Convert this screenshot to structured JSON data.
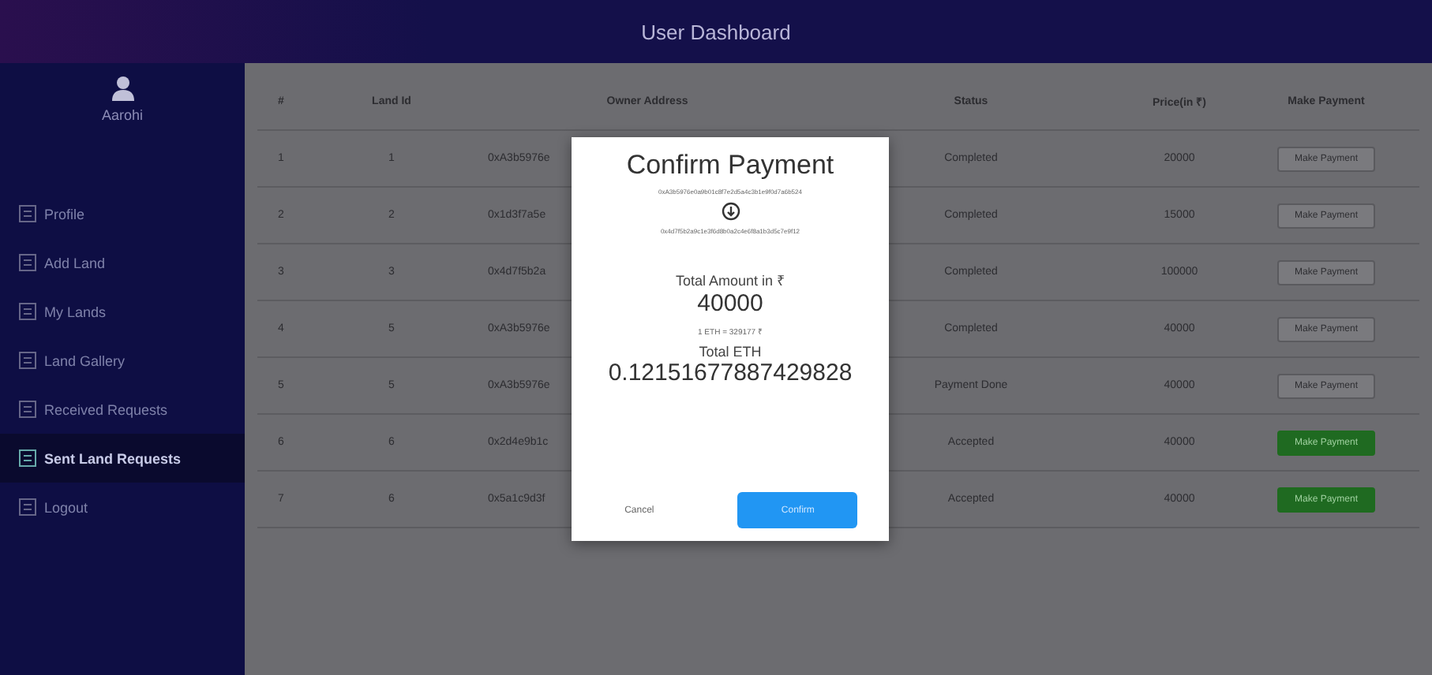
{
  "header": {
    "title": "User Dashboard"
  },
  "sidebar": {
    "user": "Aarohi",
    "items": [
      {
        "label": "Profile",
        "selected": false
      },
      {
        "label": "Add Land",
        "selected": false
      },
      {
        "label": "My Lands",
        "selected": false
      },
      {
        "label": "Land Gallery",
        "selected": false
      },
      {
        "label": "Received Requests",
        "selected": false
      },
      {
        "label": "Sent Land Requests",
        "selected": true
      },
      {
        "label": "Logout",
        "selected": false
      }
    ]
  },
  "table": {
    "columns": [
      "#",
      "Land Id",
      "Owner Address",
      "Status",
      "Price(in ₹)",
      "Make Payment"
    ],
    "rows": [
      {
        "cells": [
          "1",
          "1",
          "0xA3b5976e",
          "Completed",
          "20000"
        ],
        "button": "Make Payment",
        "disabled": true
      },
      {
        "cells": [
          "2",
          "2",
          "0x1d3f7a5e",
          "Completed",
          "15000"
        ],
        "button": "Make Payment",
        "disabled": true
      },
      {
        "cells": [
          "3",
          "3",
          "0x4d7f5b2a",
          "Completed",
          "100000"
        ],
        "button": "Make Payment",
        "disabled": true
      },
      {
        "cells": [
          "4",
          "5",
          "0xA3b5976e",
          "Completed",
          "40000"
        ],
        "button": "Make Payment",
        "disabled": true
      },
      {
        "cells": [
          "5",
          "5",
          "0xA3b5976e",
          "Payment Done",
          "40000"
        ],
        "button": "Make Payment",
        "disabled": true
      },
      {
        "cells": [
          "6",
          "6",
          "0x2d4e9b1c",
          "Accepted",
          "40000"
        ],
        "button": "Make Payment",
        "disabled": false
      },
      {
        "cells": [
          "7",
          "6",
          "0x5a1c9d3f",
          "Accepted",
          "40000"
        ],
        "button": "Make Payment",
        "disabled": false
      }
    ]
  },
  "modal": {
    "title": "Confirm Payment",
    "from": "0xA3b5976e0a9b01c8f7e2d5a4c3b1e9f0d7a6b524",
    "to": "0x4d7f5b2a9c1e3f6d8b0a2c4e6f8a1b3d5c7e9f12",
    "amount_label": "Total Amount in ₹",
    "amount": "40000",
    "rate": "1 ETH = 329177 ₹",
    "eth_label": "Total ETH",
    "eth": "0.12151677887429828",
    "cancel": "Cancel",
    "confirm": "Confirm"
  }
}
